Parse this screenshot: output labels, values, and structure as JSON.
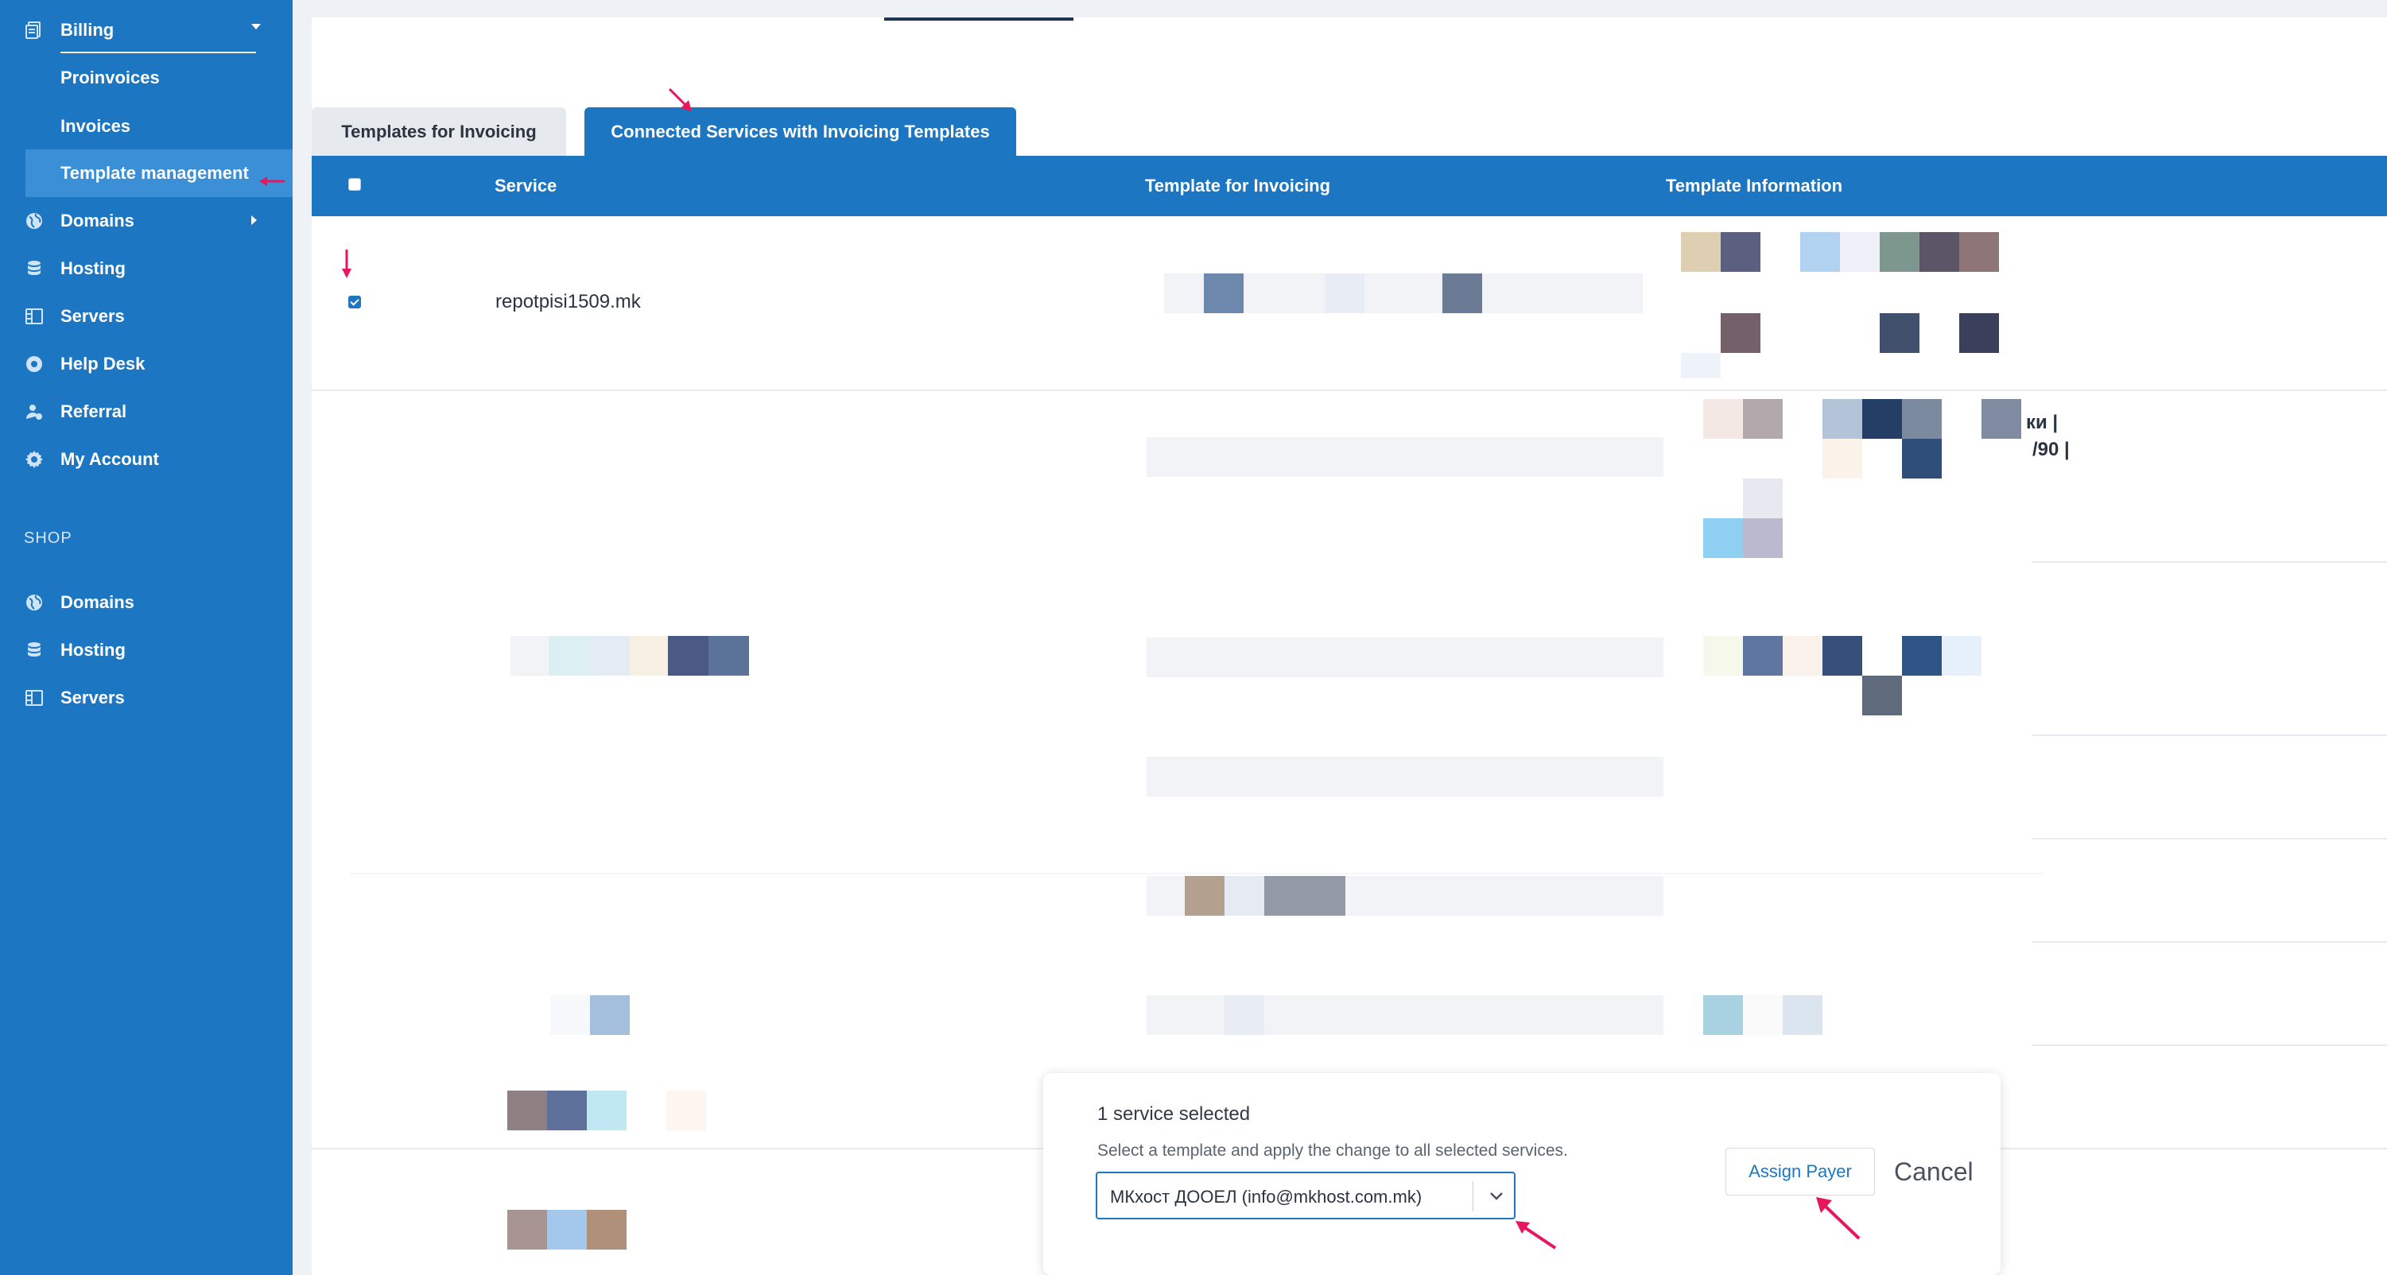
{
  "sidebar": {
    "billing_label": "Billing",
    "billing_items": [
      "Proinvoices",
      "Invoices",
      "Template management"
    ],
    "main_items": [
      {
        "label": "Domains",
        "icon": "globe-icon"
      },
      {
        "label": "Hosting",
        "icon": "database-icon"
      },
      {
        "label": "Servers",
        "icon": "server-icon"
      },
      {
        "label": "Help Desk",
        "icon": "lifebuoy-icon"
      },
      {
        "label": "Referral",
        "icon": "referral-icon"
      },
      {
        "label": "My Account",
        "icon": "gear-icon"
      }
    ],
    "shop_label": "SHOP",
    "shop_items": [
      {
        "label": "Domains",
        "icon": "globe-icon"
      },
      {
        "label": "Hosting",
        "icon": "database-icon"
      },
      {
        "label": "Servers",
        "icon": "server-icon"
      }
    ]
  },
  "tabs": {
    "templates": "Templates for Invoicing",
    "connected": "Connected Services with Invoicing Templates"
  },
  "table": {
    "headers": {
      "service": "Service",
      "template": "Template for Invoicing",
      "info": "Template Information"
    },
    "rows": [
      {
        "service": "repotpisi1509.mk",
        "checked": true
      }
    ],
    "partial_text_1": "ки |",
    "partial_text_2": "/90 |"
  },
  "panel": {
    "title": "1 service selected",
    "subtitle": "Select a template and apply the change to all selected services.",
    "select_value": "МКхост ДООЕЛ (info@mkhost.com.mk)",
    "assign_label": "Assign Payer",
    "cancel_label": "Cancel"
  },
  "colors": {
    "primary": "#1d76c1",
    "active_item": "#3a8fd6",
    "annotation_arrow": "#e8175d"
  }
}
